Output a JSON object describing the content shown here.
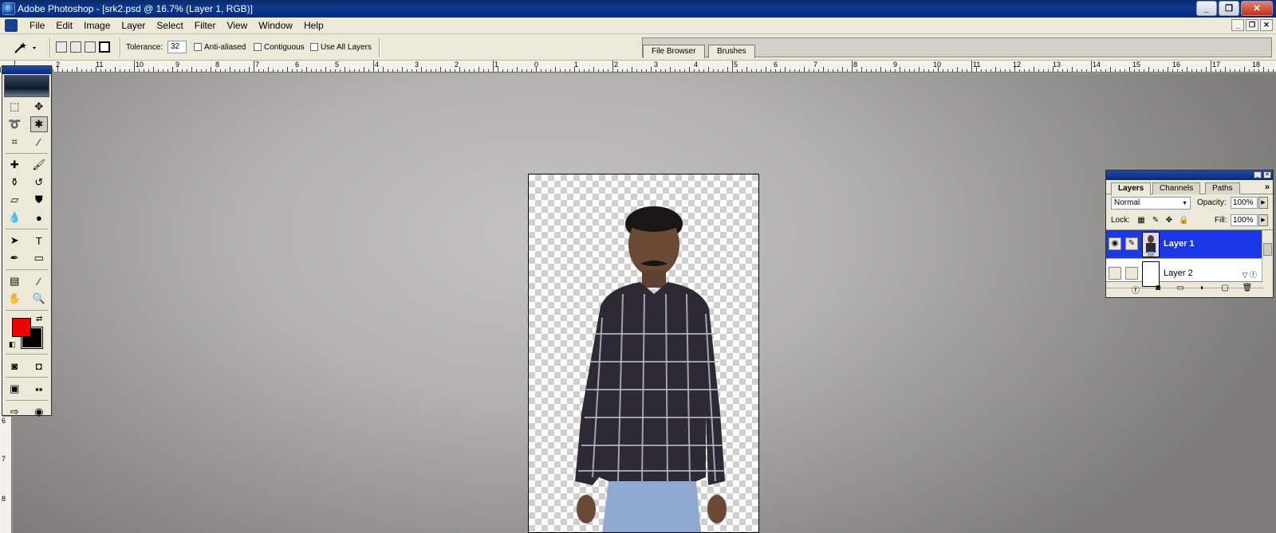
{
  "window": {
    "title": "Adobe Photoshop - [srk2.psd @ 16.7% (Layer 1, RGB)]",
    "buttons": [
      "_",
      "❐",
      "✕"
    ]
  },
  "menu": {
    "items": [
      "File",
      "Edit",
      "Image",
      "Layer",
      "Select",
      "Filter",
      "View",
      "Window",
      "Help"
    ],
    "doc_buttons": [
      "_",
      "❐",
      "✕"
    ]
  },
  "options": {
    "tolerance_label": "Tolerance:",
    "tolerance_value": "32",
    "anti_aliased": "Anti-aliased",
    "contiguous": "Contiguous",
    "use_all_layers": "Use All Layers",
    "well_tabs": [
      "File Browser",
      "Brushes"
    ]
  },
  "ruler": {
    "top_numbers": [
      "2",
      "11",
      "10",
      "9",
      "8",
      "7",
      "6",
      "5",
      "4",
      "3",
      "2",
      "1",
      "0",
      "1",
      "2",
      "3",
      "4",
      "5",
      "6",
      "7",
      "8",
      "9",
      "10",
      "11",
      "12",
      "13",
      "14",
      "15",
      "16",
      "17",
      "18"
    ],
    "left_numbers": [
      "6",
      "7",
      "8"
    ]
  },
  "colors": {
    "foreground": "#ee0000",
    "background": "#000000",
    "selected_layer": "#1a37e8"
  },
  "layers_panel": {
    "tabs": [
      "Layers",
      "Channels",
      "Paths"
    ],
    "blend_mode": "Normal",
    "opacity_label": "Opacity:",
    "opacity_value": "100%",
    "lock_label": "Lock:",
    "fill_label": "Fill:",
    "fill_value": "100%",
    "layers": [
      {
        "name": "Layer 1",
        "selected": true,
        "visible": true
      },
      {
        "name": "Layer 2",
        "selected": false,
        "visible": false
      }
    ]
  }
}
